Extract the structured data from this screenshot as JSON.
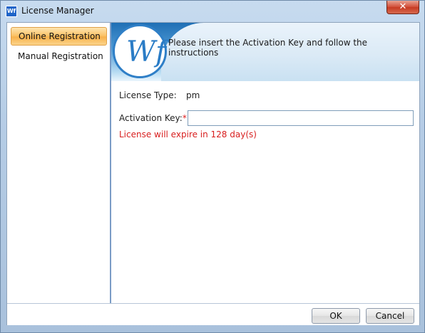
{
  "window": {
    "title": "License Manager",
    "app_icon": "wf-logo-icon",
    "close_icon": "close-icon",
    "close_glyph": "✕"
  },
  "sidebar": {
    "items": [
      {
        "label": "Online Registration",
        "active": true
      },
      {
        "label": "Manual Registration",
        "active": false
      }
    ]
  },
  "banner": {
    "logo_text": "Wf",
    "instruction": "Please insert the Activation Key and follow the instructions"
  },
  "form": {
    "license_type_label": "License Type:",
    "license_type_value": "pm",
    "activation_key_label": "Activation Key:",
    "required_marker": "*",
    "activation_key_value": "",
    "expiry_message": "License will expire in 128 day(s)"
  },
  "footer": {
    "ok_label": "OK",
    "cancel_label": "Cancel"
  },
  "colors": {
    "accent_orange": "#f8b24c",
    "error_red": "#d81e1e",
    "brand_blue": "#2a7cc6"
  }
}
